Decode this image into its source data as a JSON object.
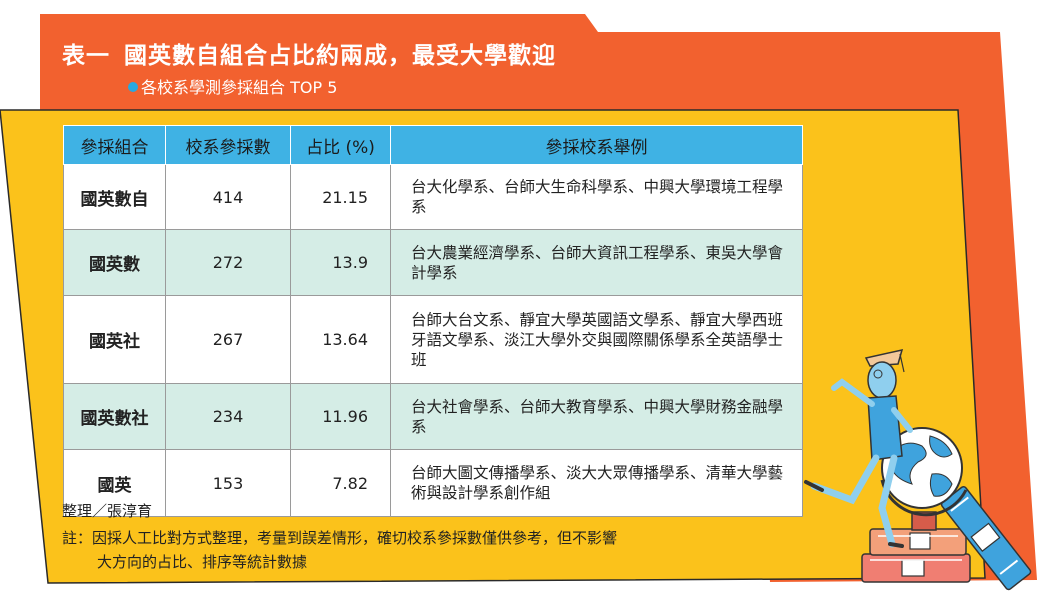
{
  "header": {
    "table_label": "表一",
    "title": "國英數自組合占比約兩成，最受大學歡迎",
    "subtitle": "各校系學測參採組合 TOP 5"
  },
  "colors": {
    "orange": "#f2612f",
    "yellow": "#fbc21b",
    "header_blue": "#3fb2e4",
    "row_tint": "#d5ede6"
  },
  "table": {
    "columns": [
      "參採組合",
      "校系參採數",
      "占比 (%)",
      "參採校系舉例"
    ],
    "rows": [
      {
        "combo": "國英數自",
        "count": "414",
        "share": "21.15",
        "examples": "台大化學系、台師大生命科學系、中興大學環境工程學系"
      },
      {
        "combo": "國英數",
        "count": "272",
        "share": "13.9",
        "examples": "台大農業經濟學系、台師大資訊工程學系、東吳大學會計學系"
      },
      {
        "combo": "國英社",
        "count": "267",
        "share": "13.64",
        "examples": "台師大台文系、靜宜大學英國語文學系、靜宜大學西班牙語文學系、淡江大學外交與國際關係學系全英語學士班"
      },
      {
        "combo": "國英數社",
        "count": "234",
        "share": "11.96",
        "examples": "台大社會學系、台師大教育學系、中興大學財務金融學系"
      },
      {
        "combo": "國英",
        "count": "153",
        "share": "7.82",
        "examples": "台師大圖文傳播學系、淡大大眾傳播學系、清華大學藝術與設計學系創作組"
      }
    ]
  },
  "footer": {
    "credit": "整理／張淳育",
    "note_line1": "註：因採人工比對方式整理，考量到誤差情形，確切校系參採數僅供參考，但不影響",
    "note_line2": "大方向的占比、排序等統計數據"
  },
  "illustration": {
    "subject": "student-with-globe-and-books-illustration"
  }
}
